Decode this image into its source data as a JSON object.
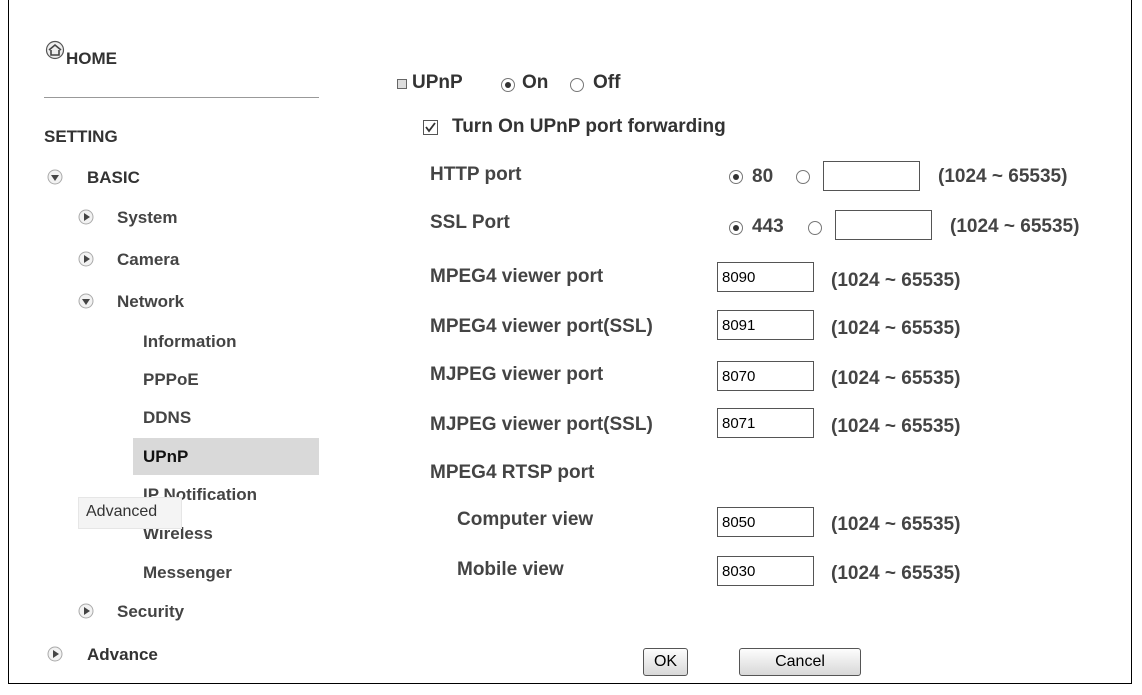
{
  "nav": {
    "home": "HOME",
    "setting": "SETTING",
    "basic": "BASIC",
    "system": "System",
    "camera": "Camera",
    "network": "Network",
    "information": "Information",
    "pppoe": "PPPoE",
    "ddns": "DDNS",
    "upnp": "UPnP",
    "ip_notification": "IP Notification",
    "wireless": "Wireless",
    "messenger": "Messenger",
    "security": "Security",
    "advance": "Advance",
    "tooltip": "Advanced"
  },
  "upnp": {
    "label": "UPnP",
    "on": "On",
    "off": "Off",
    "forwarding": "Turn On UPnP port forwarding"
  },
  "ports": {
    "http_label": "HTTP port",
    "http_default": "80",
    "http_custom": "",
    "ssl_label": "SSL Port",
    "ssl_default": "443",
    "ssl_custom": "",
    "range": "(1024 ~ 65535)",
    "mpeg4_label": "MPEG4 viewer port",
    "mpeg4_value": "8090",
    "mpeg4_ssl_label": "MPEG4 viewer port(SSL)",
    "mpeg4_ssl_value": "8091",
    "mjpeg_label": "MJPEG viewer port",
    "mjpeg_value": "8070",
    "mjpeg_ssl_label": "MJPEG viewer port(SSL)",
    "mjpeg_ssl_value": "8071",
    "rtsp_label": "MPEG4 RTSP port",
    "computer_label": "Computer view",
    "computer_value": "8050",
    "mobile_label": "Mobile view",
    "mobile_value": "8030"
  },
  "buttons": {
    "ok": "OK",
    "cancel": "Cancel"
  }
}
